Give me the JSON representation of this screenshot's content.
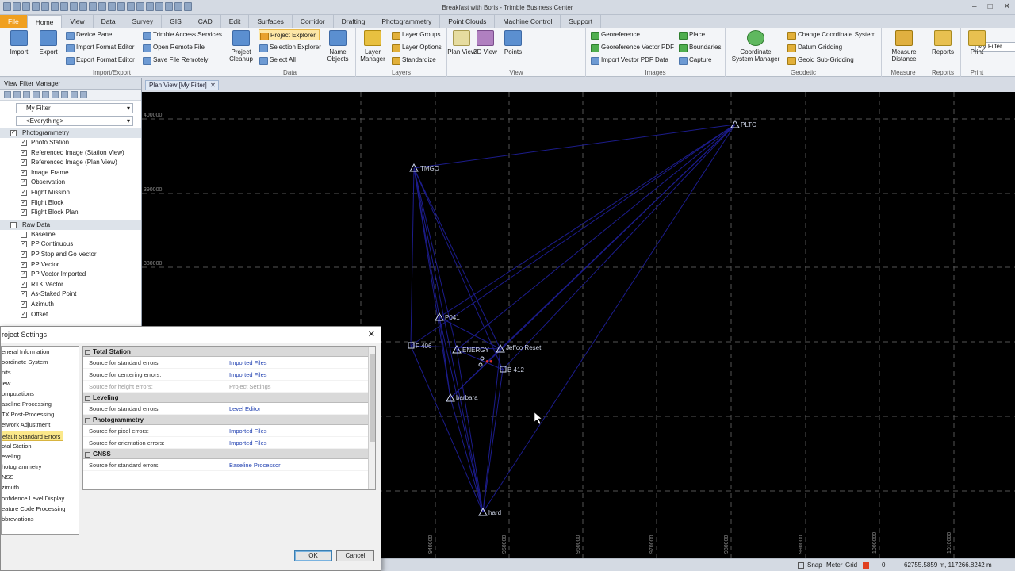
{
  "window": {
    "title": "Breakfast with Boris - Trimble Business Center"
  },
  "tabs": [
    "File",
    "Home",
    "View",
    "Data",
    "Survey",
    "GIS",
    "CAD",
    "Edit",
    "Surfaces",
    "Corridor",
    "Drafting",
    "Photogrammetry",
    "Point Clouds",
    "Machine Control",
    "Support"
  ],
  "ribbon": {
    "import": "Import",
    "export": "Export",
    "device_pane": "Device Pane",
    "import_format_editor": "Import Format Editor",
    "export_format_editor": "Export Format Editor",
    "trimble_access": "Trimble Access Services",
    "open_remote": "Open Remote File",
    "save_remote": "Save File Remotely",
    "grp_import_export": "Import/Export",
    "project_cleanup": "Project Cleanup",
    "project_explorer": "Project Explorer",
    "selection_explorer": "Selection Explorer",
    "select_all": "Select All",
    "name_objects": "Name Objects",
    "grp_data": "Data",
    "layer_manager": "Layer Manager",
    "layer_groups": "Layer Groups",
    "layer_options": "Layer Options",
    "standardize": "Standardize",
    "grp_layers": "Layers",
    "plan_view": "Plan View",
    "view_3d": "3D View",
    "points": "Points",
    "filter_value": "My Filter",
    "grp_view": "View",
    "georeference": "Georeference",
    "georef_vector_pdf": "Georeference Vector PDF",
    "import_vector_pdf": "Import Vector PDF Data",
    "place": "Place",
    "boundaries": "Boundaries",
    "capture": "Capture",
    "grp_images": "Images",
    "coord_sys_mgr": "Coordinate System Manager",
    "change_coord_sys": "Change Coordinate System",
    "datum_gridding": "Datum Gridding",
    "geoid_subgridding": "Geoid Sub-Gridding",
    "grp_geodetic": "Geodetic",
    "measure_distance": "Measure Distance",
    "grp_measure": "Measure",
    "reports": "Reports",
    "grp_reports": "Reports",
    "print": "Print",
    "grp_print": "Print"
  },
  "view_filter": {
    "title": "View Filter Manager",
    "filter": "My Filter",
    "scope": "<Everything>",
    "photogrammetry": {
      "label": "Photogrammetry",
      "items": [
        {
          "label": "Photo Station",
          "checked": true
        },
        {
          "label": "Referenced Image (Station View)",
          "checked": true
        },
        {
          "label": "Referenced Image (Plan View)",
          "checked": true
        },
        {
          "label": "Image Frame",
          "checked": true
        },
        {
          "label": "Observation",
          "checked": true
        },
        {
          "label": "Flight Mission",
          "checked": true
        },
        {
          "label": "Flight Block",
          "checked": true
        },
        {
          "label": "Flight Block Plan",
          "checked": true
        }
      ]
    },
    "raw_data": {
      "label": "Raw Data",
      "items": [
        {
          "label": "Baseline",
          "checked": false
        },
        {
          "label": "PP Continuous",
          "checked": true
        },
        {
          "label": "PP Stop and Go Vector",
          "checked": true
        },
        {
          "label": "PP Vector",
          "checked": true
        },
        {
          "label": "PP Vector Imported",
          "checked": true
        },
        {
          "label": "RTK Vector",
          "checked": true
        },
        {
          "label": "As-Staked Point",
          "checked": true
        },
        {
          "label": "Azimuth",
          "checked": true
        },
        {
          "label": "Offset",
          "checked": true
        }
      ]
    }
  },
  "doc_tab": "Plan View [My Filter]",
  "plan_view": {
    "y_labels": [
      "400000",
      "390000",
      "380000"
    ],
    "x_labels": [
      "940000",
      "950000",
      "960000",
      "970000",
      "980000",
      "990000",
      "1000000",
      "1010000"
    ],
    "points": [
      {
        "name": "PLTC"
      },
      {
        "name": "TMGO"
      },
      {
        "name": "P041"
      },
      {
        "name": "F 406"
      },
      {
        "name": "ENERGY"
      },
      {
        "name": "Jeffco Reset"
      },
      {
        "name": "B 412"
      },
      {
        "name": "barbara"
      },
      {
        "name": "hard"
      }
    ]
  },
  "status": {
    "snap": "Snap",
    "units": "Meter",
    "grid": "Grid",
    "count": "0",
    "coords": "62755.5859 m, 117266.8242 m"
  },
  "dialog": {
    "title": "roject Settings",
    "nav": [
      "eneral Information",
      "oordinate System",
      "nits",
      "iew",
      "omputations",
      "aseline Processing",
      "TX Post-Processing",
      "etwork Adjustment",
      "efault Standard Errors",
      "otal Station",
      "eveling",
      "hotogrammetry",
      "NSS",
      "zimuth",
      "onfidence Level Display",
      "eature Code Processing",
      "bbreviations"
    ],
    "sections": [
      {
        "title": "Total Station",
        "rows": [
          {
            "k": "Source for standard errors:",
            "v": "Imported Files"
          },
          {
            "k": "Source for centering errors:",
            "v": "Imported Files"
          },
          {
            "k": "Source for height errors:",
            "v": "Project Settings"
          }
        ]
      },
      {
        "title": "Leveling",
        "rows": [
          {
            "k": "Source for standard errors:",
            "v": "Level Editor"
          }
        ]
      },
      {
        "title": "Photogrammetry",
        "rows": [
          {
            "k": "Source for pixel errors:",
            "v": "Imported Files"
          },
          {
            "k": "Source for orientation errors:",
            "v": "Imported Files"
          }
        ]
      },
      {
        "title": "GNSS",
        "rows": [
          {
            "k": "Source for standard errors:",
            "v": "Baseline Processor"
          }
        ]
      }
    ],
    "ok": "OK",
    "cancel": "Cancel"
  }
}
